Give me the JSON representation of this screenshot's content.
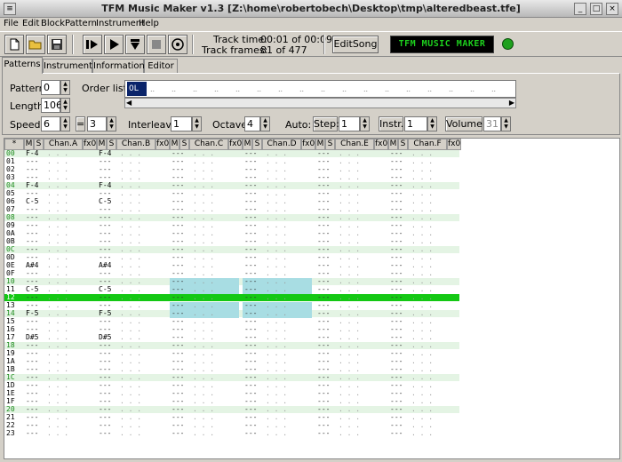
{
  "window": {
    "title": "TFM Music Maker v1.3 [Z:\\home\\robertobech\\Desktop\\tmp\\alteredbeast.tfe]"
  },
  "menu": [
    "File",
    "Edit",
    "Block",
    "Pattern",
    "Instrument",
    "Help"
  ],
  "toolbar": {
    "track_time_label": "Track time:",
    "track_time_value": "00:01 of 00:09",
    "track_frames_label": "Track frames:",
    "track_frames_value": "81 of 477",
    "editsong_label": "EditSong",
    "logo_text": "TFM MUSIC MAKER",
    "led_color": "#1ea01e"
  },
  "tabs": [
    "Patterns",
    "Instruments",
    "Information",
    "Editor"
  ],
  "active_tab": "Patterns",
  "panel": {
    "pattern_label": "Pattern:",
    "pattern_value": "0",
    "length_label": "Length:",
    "length_value": "106",
    "speed_label": "Speed:",
    "speed_value": "6",
    "speed_op": "=",
    "speed_value2": "3",
    "orderlist_label": "Order list:",
    "orderlist_first": "0L",
    "interleave_label": "Interleave:",
    "interleave_value": "1",
    "octave_label": "Octave:",
    "octave_value": "4",
    "auto_label": "Auto:",
    "step_label": "Step:",
    "step_value": "1",
    "instr_label": "Instr.:",
    "instr_value": "1",
    "volume_label": "Volume:",
    "volume_value": "31"
  },
  "grid": {
    "corner": "*",
    "channels": [
      "Chan.A",
      "Chan.B",
      "Chan.C",
      "Chan.D",
      "Chan.E",
      "Chan.F"
    ],
    "col_m": "M",
    "col_s": "S",
    "col_fx": "fx0",
    "row_labels": [
      "00",
      "01",
      "02",
      "03",
      "04",
      "05",
      "06",
      "07",
      "08",
      "09",
      "0A",
      "0B",
      "0C",
      "0D",
      "0E",
      "0F",
      "10",
      "11",
      "12",
      "13",
      "14",
      "15",
      "16",
      "17",
      "18",
      "19",
      "1A",
      "1B",
      "1C",
      "1D",
      "1E",
      "1F",
      "20",
      "21",
      "22",
      "23"
    ],
    "current_row": "12",
    "notes": {
      "Chan.A": {
        "00": "F-4",
        "04": "F-4",
        "06": "C-5",
        "0E": "A#4",
        "11": "C-5",
        "14": "F-5",
        "17": "D#5"
      },
      "Chan.B": {
        "00": "F-4",
        "04": "F-4",
        "06": "C-5",
        "0E": "A#4",
        "11": "C-5",
        "14": "F-5",
        "17": "D#5"
      }
    },
    "empty_note": "---",
    "dots": ". . ."
  },
  "colors": {
    "highlight_row": "#14c814",
    "beat_row": "#e4f4e4",
    "beat_label": "#1a8a1a",
    "block_select": "#a8dde3",
    "accent_blue": "#0a246a"
  }
}
